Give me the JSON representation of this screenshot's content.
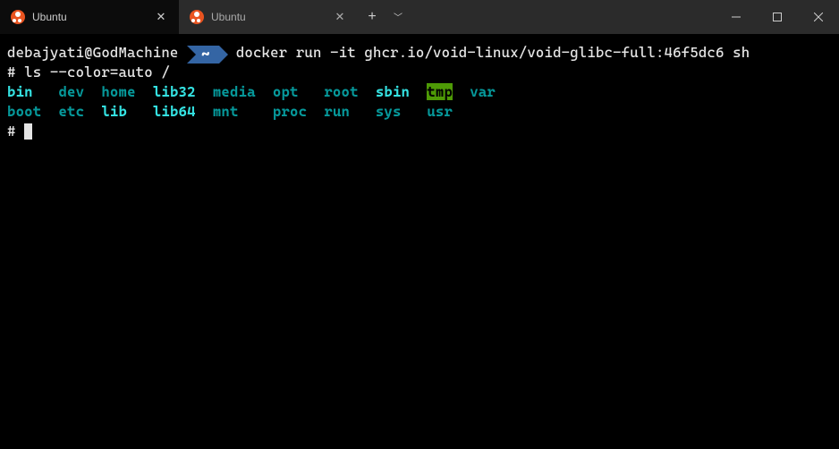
{
  "window": {
    "tabs": [
      {
        "title": "Ubuntu",
        "active": true
      },
      {
        "title": "Ubuntu",
        "active": false
      }
    ]
  },
  "prompt": {
    "user_host": "debajyati@GodMachine",
    "path_symbol": "~",
    "command": "docker run -it ghcr.io/void-linux/void-glibc-full:46f5dc6 sh"
  },
  "ls": {
    "prompt": "#",
    "command": "ls --color=auto /",
    "row1": [
      "bin",
      "dev",
      "home",
      "lib32",
      "media",
      "opt",
      "root",
      "sbin",
      "tmp",
      "var"
    ],
    "row2": [
      "boot",
      "etc",
      "lib",
      "lib64",
      "mnt",
      "proc",
      "run",
      "sys",
      "usr"
    ]
  },
  "current_prompt": "#"
}
